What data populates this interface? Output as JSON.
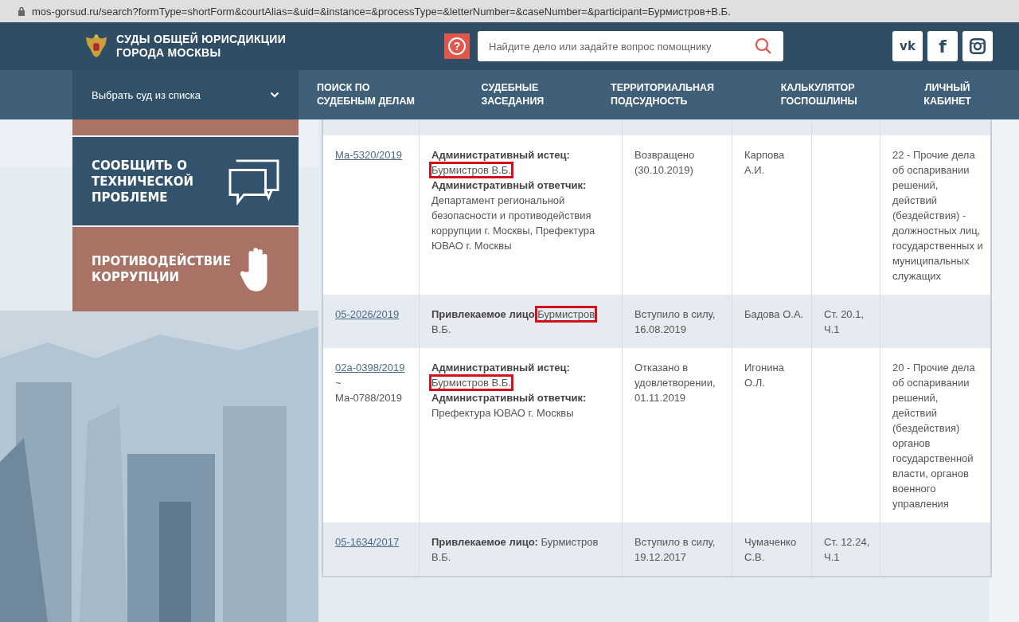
{
  "address_bar": {
    "url": "mos-gorsud.ru/search?formType=shortForm&courtAlias=&uid=&instance=&processType=&letterNumber=&caseNumber=&participant=Бурмистров+В.Б."
  },
  "header": {
    "title_lines": [
      "СУДЫ ОБЩЕЙ ЮРИСДИКЦИИ",
      "ГОРОДА МОСКВЫ"
    ],
    "help": "?",
    "search": {
      "placeholder": "Найдите дело или задайте вопрос помощнику"
    },
    "social": [
      {
        "kind": "vk",
        "label": "vk"
      },
      {
        "kind": "facebook",
        "label": "f"
      },
      {
        "kind": "instagram"
      }
    ]
  },
  "nav": {
    "court_select": "Выбрать суд из списка",
    "items": [
      {
        "lines": [
          "ПОИСК ПО",
          "СУДЕБНЫМ ДЕЛАМ"
        ]
      },
      {
        "lines": [
          "СУДЕБНЫЕ",
          "ЗАСЕДАНИЯ"
        ]
      },
      {
        "lines": [
          "ТЕРРИТОРИАЛЬНАЯ",
          "ПОДСУДНОСТЬ"
        ]
      },
      {
        "lines": [
          "КАЛЬКУЛЯТОР",
          "ГОСПОШЛИНЫ"
        ]
      },
      {
        "lines": [
          "ЛИЧНЫЙ",
          "КАБИНЕТ"
        ]
      }
    ]
  },
  "sidebar": {
    "banners": [
      {
        "kind": "cut"
      },
      {
        "kind": "report",
        "lines": [
          "СООБЩИТЬ О",
          "ТЕХНИЧЕСКОЙ",
          "ПРОБЛЕМЕ"
        ]
      },
      {
        "kind": "anticorruption",
        "lines": [
          "ПРОТИВОДЕЙСТВИЕ",
          "КОРРУПЦИИ"
        ]
      }
    ]
  },
  "table": {
    "rows": [
      {
        "case": [
          {
            "text": "Ма-5320/2019",
            "link": true
          }
        ],
        "parties": [
          {
            "label": "Административный истец:",
            "name": [
              {
                "text": "Бурмистров В.Б.",
                "highlighted": true
              }
            ]
          },
          {
            "label": "Административный ответчик:",
            "name": [
              {
                "text": "Департамент региональной безопасности и противодействия коррупции г. Москвы, Префектура ЮВАО г. Москвы",
                "highlighted": false
              }
            ]
          }
        ],
        "status": "Возвращено (30.10.2019)",
        "judge": "Карпова А.И.",
        "category": "22 - Прочие дела об оспаривании решений, действий (бездействия) - должностных лиц, государственных и муниципальных служащих"
      },
      {
        "case": [
          {
            "text": "05-2026/2019",
            "link": true
          }
        ],
        "parties": [
          {
            "label": "Привлекаемое лицо",
            "name": [
              {
                "text": "Бурмистров",
                "highlighted": true
              },
              {
                "text": "В.Б.",
                "highlighted": false
              }
            ]
          }
        ],
        "status": "Вступило в силу, 16.08.2019",
        "judge": "Бадова О.А.",
        "article": "Ст. 20.1, Ч.1"
      },
      {
        "case": [
          {
            "text": "02а-0398/2019",
            "link": true
          },
          {
            "text": "~",
            "link": false
          },
          {
            "text": "Ма-0788/2019",
            "link": false
          }
        ],
        "parties": [
          {
            "label": "Административный истец:",
            "name": [
              {
                "text": "Бурмистров В.Б.",
                "highlighted": true
              }
            ]
          },
          {
            "label": "Административный ответчик:",
            "name": [
              {
                "text": "Префектура ЮВАО г. Москвы",
                "highlighted": false
              }
            ]
          }
        ],
        "status": "Отказано в удовлетворении, 01.11.2019",
        "judge": "Игонина О.Л.",
        "category": "20 - Прочие дела об оспаривании решений, действий (бездействия) органов государственной власти, органов военного управления"
      },
      {
        "case": [
          {
            "text": "05-1634/2017",
            "link": true
          }
        ],
        "parties": [
          {
            "label": "Привлекаемое лицо:",
            "name": [
              {
                "text": "Бурмистров",
                "highlighted": false
              },
              {
                "text": "В.Б.",
                "highlighted": false
              }
            ]
          }
        ],
        "status": "Вступило в силу, 19.12.2017",
        "judge": "Чумаченко С.В.",
        "article": "Ст. 12.24, Ч.1"
      }
    ]
  }
}
